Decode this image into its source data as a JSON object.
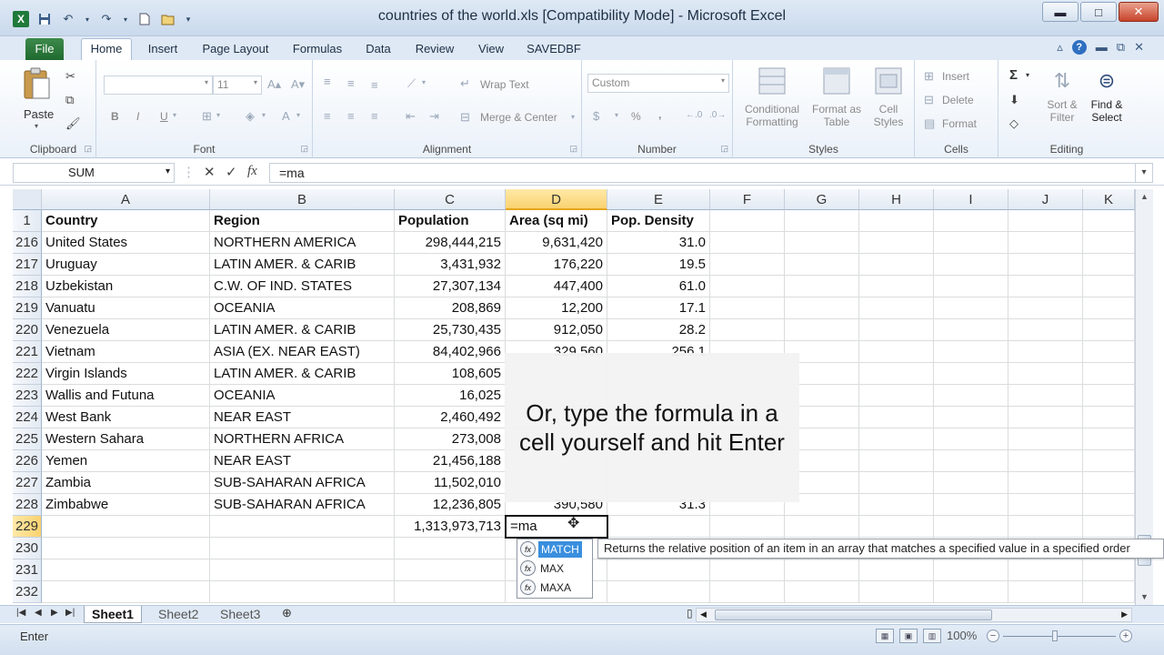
{
  "window": {
    "title": "countries of the world.xls  [Compatibility Mode]  -  Microsoft Excel",
    "minimize": "▬",
    "maximize": "□",
    "close": "✕"
  },
  "tabs": [
    "File",
    "Home",
    "Insert",
    "Page Layout",
    "Formulas",
    "Data",
    "Review",
    "View",
    "SAVEDBF"
  ],
  "ribbon": {
    "clipboard": {
      "label": "Clipboard",
      "paste": "Paste"
    },
    "font": {
      "label": "Font",
      "size": "11",
      "bold": "B",
      "italic": "I",
      "underline": "U"
    },
    "alignment": {
      "label": "Alignment",
      "wrap_text": "Wrap Text",
      "merge_center": "Merge & Center"
    },
    "number": {
      "label": "Number",
      "format": "Custom",
      "percent": "%",
      "comma": ","
    },
    "styles": {
      "label": "Styles",
      "conditional1": "Conditional",
      "conditional2": "Formatting",
      "format_as1": "Format as",
      "format_as2": "Table",
      "cell_styles1": "Cell",
      "cell_styles2": "Styles"
    },
    "cells": {
      "label": "Cells",
      "insert": "Insert",
      "delete": "Delete",
      "format": "Format"
    },
    "editing": {
      "label": "Editing",
      "sigma": "Σ",
      "sort1": "Sort &",
      "sort2": "Filter",
      "find1": "Find &",
      "find2": "Select"
    }
  },
  "formula_bar": {
    "name_box": "SUM",
    "cancel": "✕",
    "enter": "✓",
    "fx": "fx",
    "formula": "=ma"
  },
  "columns": [
    "A",
    "B",
    "C",
    "D",
    "E",
    "F",
    "G",
    "H",
    "I",
    "J",
    "K"
  ],
  "headers": {
    "row": "1",
    "country": "Country",
    "region": "Region",
    "population": "Population",
    "area": "Area (sq mi)",
    "density": "Pop. Density"
  },
  "rows": [
    {
      "n": "216",
      "country": "United States",
      "region": "NORTHERN AMERICA",
      "population": "298,444,215",
      "area": "9,631,420",
      "density": "31.0"
    },
    {
      "n": "217",
      "country": "Uruguay",
      "region": "LATIN AMER. & CARIB",
      "population": "3,431,932",
      "area": "176,220",
      "density": "19.5"
    },
    {
      "n": "218",
      "country": "Uzbekistan",
      "region": "C.W. OF IND. STATES",
      "population": "27,307,134",
      "area": "447,400",
      "density": "61.0"
    },
    {
      "n": "219",
      "country": "Vanuatu",
      "region": "OCEANIA",
      "population": "208,869",
      "area": "12,200",
      "density": "17.1"
    },
    {
      "n": "220",
      "country": "Venezuela",
      "region": "LATIN AMER. & CARIB",
      "population": "25,730,435",
      "area": "912,050",
      "density": "28.2"
    },
    {
      "n": "221",
      "country": "Vietnam",
      "region": "ASIA (EX. NEAR EAST)",
      "population": "84,402,966",
      "area": "329,560",
      "density": "256.1"
    },
    {
      "n": "222",
      "country": "Virgin Islands",
      "region": "LATIN AMER. & CARIB",
      "population": "108,605",
      "area": "",
      "density": ""
    },
    {
      "n": "223",
      "country": "Wallis and Futuna",
      "region": "OCEANIA",
      "population": "16,025",
      "area": "",
      "density": ""
    },
    {
      "n": "224",
      "country": "West Bank",
      "region": "NEAR EAST",
      "population": "2,460,492",
      "area": "",
      "density": ""
    },
    {
      "n": "225",
      "country": "Western Sahara",
      "region": "NORTHERN AFRICA",
      "population": "273,008",
      "area": "",
      "density": ""
    },
    {
      "n": "226",
      "country": "Yemen",
      "region": "NEAR EAST",
      "population": "21,456,188",
      "area": "",
      "density": ""
    },
    {
      "n": "227",
      "country": "Zambia",
      "region": "SUB-SAHARAN AFRICA",
      "population": "11,502,010",
      "area": "",
      "density": ""
    },
    {
      "n": "228",
      "country": "Zimbabwe",
      "region": "SUB-SAHARAN AFRICA",
      "population": "12,236,805",
      "area": "390,580",
      "density": "31.3"
    }
  ],
  "total_row": {
    "n": "229",
    "population": "1,313,973,713",
    "edit": "=ma"
  },
  "empty_rows": [
    "230",
    "231",
    "232"
  ],
  "autocomplete": {
    "items": [
      "MATCH",
      "MAX",
      "MAXA"
    ],
    "tooltip": "Returns the relative position of an item in an array that matches a specified value in a specified order"
  },
  "callout": "Or, type the formula in a cell yourself and hit Enter",
  "sheets": [
    "Sheet1",
    "Sheet2",
    "Sheet3"
  ],
  "status": {
    "mode": "Enter",
    "zoom": "100%",
    "zoom_level_percent": 100
  }
}
